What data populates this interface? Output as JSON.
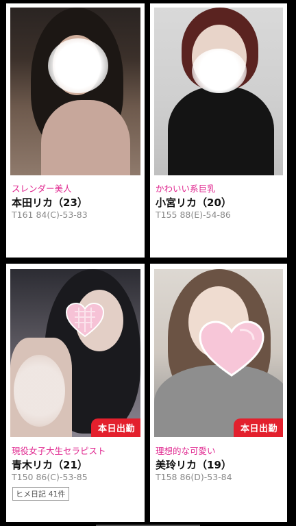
{
  "cards": [
    {
      "catch": "スレンダー美人",
      "name": "本田リカ（23）",
      "stats": "T161 84(C)-53-83",
      "badge": "",
      "diary": ""
    },
    {
      "catch": "かわいい系巨乳",
      "name": "小宮リカ（20）",
      "stats": "T155 88(E)-54-86",
      "badge": "",
      "diary": ""
    },
    {
      "catch": "現役女子大生セラピスト",
      "name": "青木リカ（21）",
      "stats": "T150 86(C)-53-85",
      "badge": "本日出勤",
      "diary": "ヒメ日記 41件"
    },
    {
      "catch": "理想的な可愛い",
      "name": "美玲リカ（19）",
      "stats": "T158 86(D)-53-84",
      "badge": "本日出勤",
      "diary": ""
    }
  ],
  "colors": {
    "catch": "#e0278f",
    "badge": "#e3202d",
    "background": "#000000"
  },
  "icons": {
    "face_cover": "heart-sticker-icon"
  }
}
